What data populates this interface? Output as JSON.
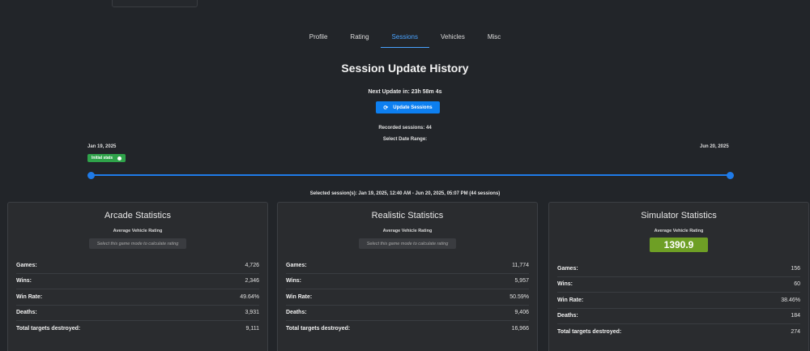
{
  "tabs": [
    {
      "label": "Profile",
      "active": false
    },
    {
      "label": "Rating",
      "active": false
    },
    {
      "label": "Sessions",
      "active": true
    },
    {
      "label": "Vehicles",
      "active": false
    },
    {
      "label": "Misc",
      "active": false
    }
  ],
  "page_title": "Session Update History",
  "next_update": "Next Update in: 23h 58m 4s",
  "update_button": {
    "label": "Update Sessions",
    "icon": "refresh-icon"
  },
  "recorded_sessions": "Recorded sessions: 44",
  "date_range_label": "Select Date Range:",
  "slider": {
    "start_date": "Jan 19, 2025",
    "end_date": "Jun 20, 2025",
    "initial_badge": "Initial stats",
    "accent_color": "#1f7be8"
  },
  "selected_range": "Selected session(s): Jan 19, 2025, 12:40 AM - Jun 20, 2025, 05:07 PM (44 sessions)",
  "cards": [
    {
      "title": "Arcade Statistics",
      "avg_label": "Average Vehicle Rating",
      "hint": "Select this game mode to calculate rating",
      "stats": [
        {
          "label": "Games:",
          "value": "4,726"
        },
        {
          "label": "Wins:",
          "value": "2,346"
        },
        {
          "label": "Win Rate:",
          "value": "49.64%"
        },
        {
          "label": "Deaths:",
          "value": "3,931"
        },
        {
          "label": "Total targets destroyed:",
          "value": "9,111"
        }
      ]
    },
    {
      "title": "Realistic Statistics",
      "avg_label": "Average Vehicle Rating",
      "hint": "Select this game mode to calculate rating",
      "stats": [
        {
          "label": "Games:",
          "value": "11,774"
        },
        {
          "label": "Wins:",
          "value": "5,957"
        },
        {
          "label": "Win Rate:",
          "value": "50.59%"
        },
        {
          "label": "Deaths:",
          "value": "9,406"
        },
        {
          "label": "Total targets destroyed:",
          "value": "16,966"
        }
      ]
    },
    {
      "title": "Simulator Statistics",
      "avg_label": "Average Vehicle Rating",
      "rating": "1390.9",
      "rating_color": "#6e9f25",
      "stats": [
        {
          "label": "Games:",
          "value": "156"
        },
        {
          "label": "Wins:",
          "value": "60"
        },
        {
          "label": "Win Rate:",
          "value": "38.46%"
        },
        {
          "label": "Deaths:",
          "value": "184"
        },
        {
          "label": "Total targets destroyed:",
          "value": "274"
        }
      ]
    }
  ]
}
